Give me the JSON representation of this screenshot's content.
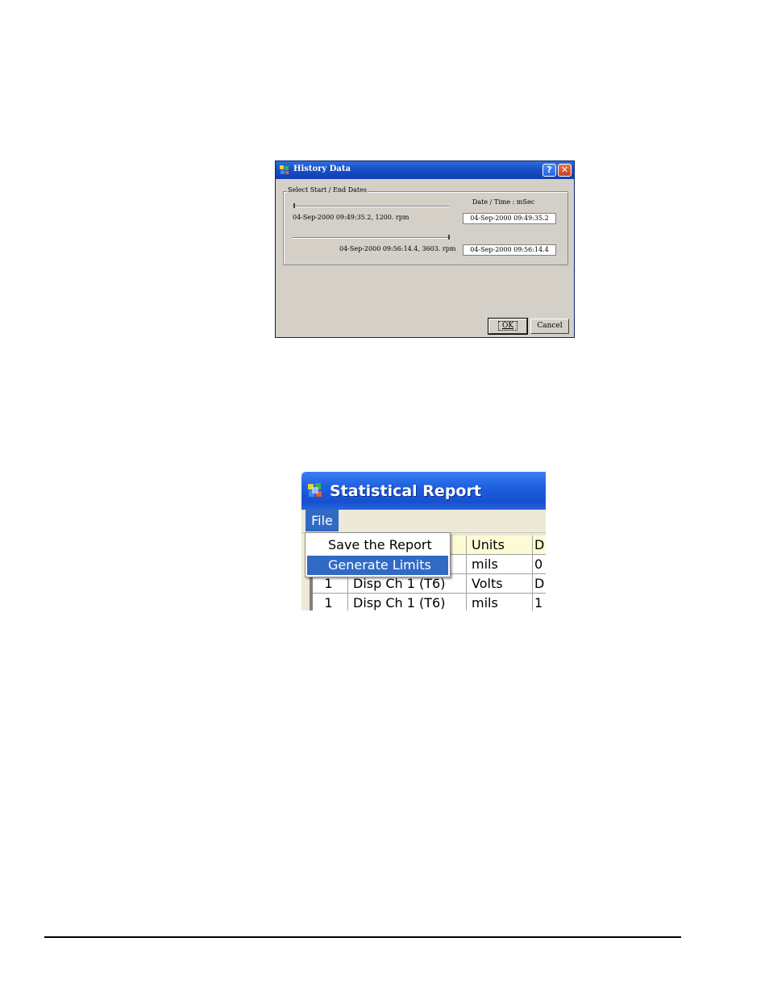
{
  "history_dialog": {
    "title": "History Data",
    "group_label": "Select Start / End Dates",
    "column_header": "Date / Time : mSec",
    "start_slider_label": "04-Sep-2000 09:49:35.2, 1200. rpm",
    "end_slider_label": "04-Sep-2000 09:56:14.4, 3603. rpm",
    "start_value": "04-Sep-2000 09:49:35.2",
    "end_value": "04-Sep-2000 09:56:14.4",
    "help_glyph": "?",
    "close_glyph": "✕",
    "ok_label": "OK",
    "cancel_label": "Cancel"
  },
  "report_window": {
    "title": "Statistical Report",
    "menu": {
      "file_label": "File"
    },
    "file_menu_items": [
      {
        "label": "Save the Report",
        "selected": false
      },
      {
        "label": "Generate Limits",
        "selected": true
      }
    ],
    "table": {
      "header": {
        "units": "Units",
        "next": "D"
      },
      "rows": [
        {
          "num": "",
          "name": "",
          "units": "mils",
          "next": "0"
        },
        {
          "num": "1",
          "name": "Disp Ch  1 (T6)",
          "units": "Volts",
          "next": "D"
        },
        {
          "num": "1",
          "name": "Disp Ch  1 (T6)",
          "units": "mils",
          "next": "1"
        }
      ]
    }
  },
  "colors": {
    "selection": "#316ac5",
    "xp_title_blue": "#1f5fe0",
    "dialog_face": "#d4d0c8"
  }
}
